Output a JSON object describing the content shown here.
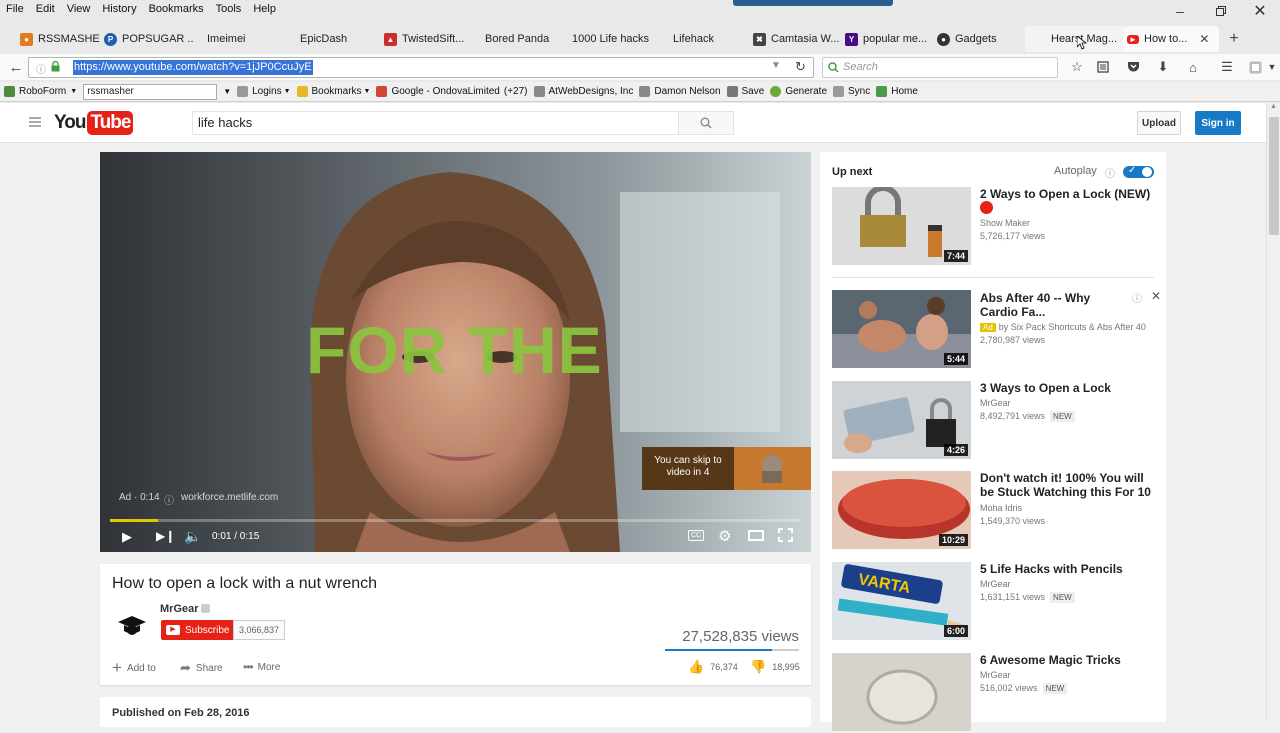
{
  "menu": [
    "File",
    "Edit",
    "View",
    "History",
    "Bookmarks",
    "Tools",
    "Help"
  ],
  "tabs": [
    {
      "label": "RSSMASHE...",
      "icon": "rss-icon",
      "color": "#e07b24"
    },
    {
      "label": "POPSUGAR ...",
      "icon": "popsugar-icon",
      "color": "#1d5fb0"
    },
    {
      "label": "Imeimei",
      "icon": "",
      "color": ""
    },
    {
      "label": "EpicDash",
      "icon": "",
      "color": ""
    },
    {
      "label": "TwistedSift...",
      "icon": "twisted-icon",
      "color": "#c9302c"
    },
    {
      "label": "Bored Panda",
      "icon": "",
      "color": ""
    },
    {
      "label": "1000 Life hacks",
      "icon": "",
      "color": ""
    },
    {
      "label": "Lifehack",
      "icon": "",
      "color": ""
    },
    {
      "label": "Camtasia W...",
      "icon": "camtasia-icon",
      "color": "#444"
    },
    {
      "label": "popular me...",
      "icon": "yahoo-icon",
      "color": "#4a0b8a"
    },
    {
      "label": "Gadgets",
      "icon": "gadgets-icon",
      "color": "#333"
    },
    {
      "label": "Hearst Mag...",
      "icon": "",
      "color": ""
    },
    {
      "label": "How to...",
      "icon": "youtube-icon",
      "color": "#e62117"
    }
  ],
  "url": "https://www.youtube.com/watch?v=1jJP0CcuJyE",
  "search_placeholder": "Search",
  "bookmarks": {
    "roboform": "RoboForm",
    "roboform_field": "rssmasher",
    "items": [
      "Logins",
      "Bookmarks",
      "Google - OndovaLimited",
      "(+27)",
      "AtWebDesigns, Inc",
      "Damon Nelson",
      "Save",
      "Generate",
      "Sync",
      "Home"
    ]
  },
  "yt": {
    "logo_you": "You",
    "logo_tube": "Tube",
    "search_value": "life hacks",
    "upload": "Upload",
    "signin": "Sign in"
  },
  "player": {
    "overlay_text": "FOR THE",
    "ad_label": "Ad · 0:14",
    "ad_site": "workforce.metlife.com",
    "skip_text": "You can skip to video in 4",
    "time": "0:01 / 0:15",
    "progress": 0.07
  },
  "video": {
    "title": "How to open a lock with a nut wrench",
    "channel": "MrGear",
    "subscribe": "Subscribe",
    "subscribers": "3,066,837",
    "views": "27,528,835 views",
    "add_to": "Add to",
    "share": "Share",
    "more": "More",
    "likes": "76,374",
    "dislikes": "18,995",
    "published": "Published on Feb 28, 2016"
  },
  "sidebar": {
    "up_next": "Up next",
    "autoplay": "Autoplay",
    "videos": [
      {
        "title": "2 Ways to Open a Lock (NEW)",
        "channel": "Show Maker",
        "views": "5,726,177 views",
        "duration": "7:44",
        "badge": "",
        "ad": false
      },
      {
        "title": "Abs After 40 -- Why Cardio Fa...",
        "channel": "by Six Pack Shortcuts & Abs After 40",
        "views": "2,780,987 views",
        "duration": "5:44",
        "badge": "",
        "ad": true
      },
      {
        "title": "3 Ways to Open a Lock",
        "channel": "MrGear",
        "views": "8,492,791 views",
        "duration": "4:26",
        "badge": "NEW",
        "ad": false
      },
      {
        "title": "Don't watch it! 100% You will be Stuck Watching this For 10",
        "channel": "Moha Idris",
        "views": "1,549,370 views",
        "duration": "10:29",
        "badge": "",
        "ad": false
      },
      {
        "title": "5 Life Hacks with Pencils",
        "channel": "MrGear",
        "views": "1,631,151 views",
        "duration": "6:00",
        "badge": "NEW",
        "ad": false
      },
      {
        "title": "6 Awesome Magic Tricks",
        "channel": "MrGear",
        "views": "516,002 views",
        "duration": "",
        "badge": "NEW",
        "ad": false
      }
    ],
    "ad_label": "Ad"
  }
}
